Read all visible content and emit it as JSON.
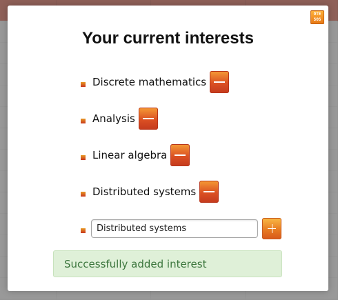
{
  "modal": {
    "title": "Your current interests",
    "close_button_text": "OTE\nSOS"
  },
  "interests": [
    {
      "label": "Discrete mathematics"
    },
    {
      "label": "Analysis"
    },
    {
      "label": "Linear algebra"
    },
    {
      "label": "Distributed systems"
    }
  ],
  "add_form": {
    "input_value": "Distributed systems"
  },
  "alert": {
    "message": "Successfully added interest"
  },
  "colors": {
    "accent_orange": "#e77b22",
    "remove_button_red": "#db5023",
    "success_background": "#dff0d8",
    "success_text": "#3c763d"
  },
  "icons": {
    "remove": "minus-icon",
    "add": "plus-icon",
    "close": "close-icon"
  }
}
